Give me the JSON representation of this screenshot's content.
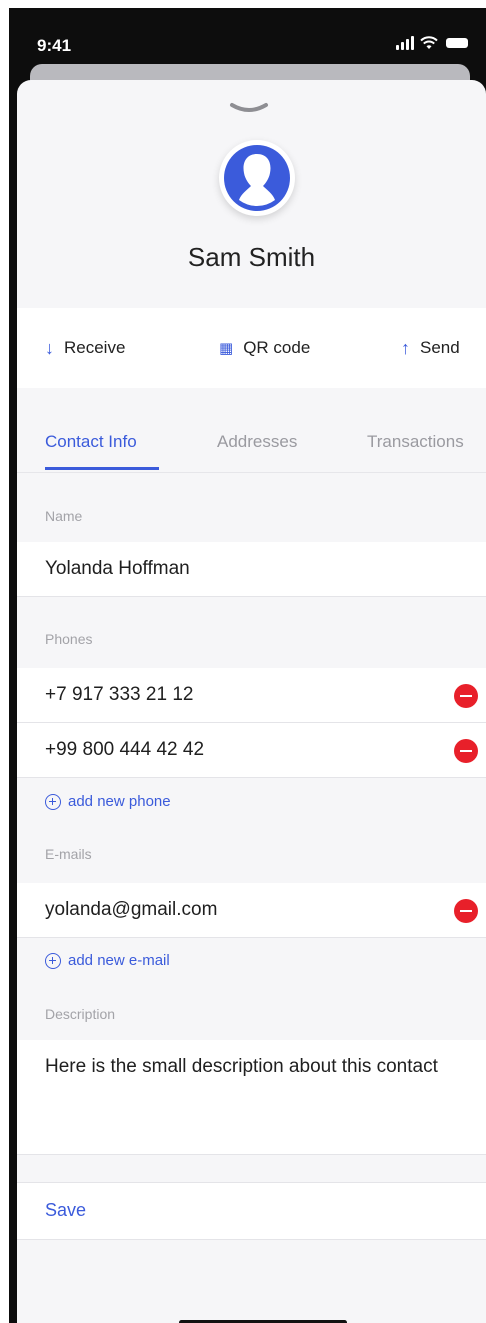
{
  "status_bar": {
    "time": "9:41"
  },
  "contact": {
    "name": "Sam Smith"
  },
  "actions": [
    {
      "label": "Receive",
      "icon": "arrow-down-icon",
      "glyph": "↓"
    },
    {
      "label": "QR code",
      "icon": "qr-code-icon",
      "glyph": "▦"
    },
    {
      "label": "Send",
      "icon": "arrow-up-icon",
      "glyph": "↑"
    }
  ],
  "tabs": [
    {
      "label": "Contact Info",
      "active": true
    },
    {
      "label": "Addresses",
      "active": false
    },
    {
      "label": "Transactions",
      "active": false
    }
  ],
  "form": {
    "name_label": "Name",
    "name_value": "Yolanda Hoffman",
    "phones_label": "Phones",
    "phones": [
      "+7 917 333 21 12",
      "+99 800 444 42 42"
    ],
    "add_phone": "add new phone",
    "emails_label": "E-mails",
    "emails": [
      "yolanda@gmail.com"
    ],
    "add_email": "add new e-mail",
    "description_label": "Description",
    "description_value": "Here is the small description about this contact",
    "save": "Save"
  },
  "colors": {
    "accent": "#3b5bdb",
    "danger": "#e8202a",
    "background": "#f6f6f8"
  }
}
